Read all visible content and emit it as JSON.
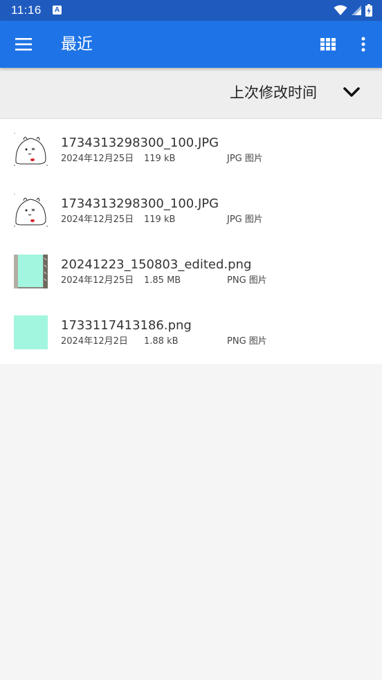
{
  "status_bar": {
    "time": "11:16",
    "notification_glyph": "A",
    "icons": [
      "wifi-icon",
      "signal-icon",
      "battery-icon"
    ]
  },
  "app_bar": {
    "title": "最近",
    "icons": [
      "menu-icon",
      "grid-view-icon",
      "more-vert-icon"
    ],
    "color": "#1e74e6"
  },
  "sort": {
    "label": "上次修改时间",
    "icon": "chevron-down-icon"
  },
  "files": [
    {
      "name": "1734313298300_100.JPG",
      "date": "2024年12月25日",
      "size": "119 kB",
      "type": "JPG 图片",
      "thumb": "cartoon"
    },
    {
      "name": "1734313298300_100.JPG",
      "date": "2024年12月25日",
      "size": "119 kB",
      "type": "JPG 图片",
      "thumb": "cartoon"
    },
    {
      "name": "20241223_150803_edited.png",
      "date": "2024年12月25日",
      "size": "1.85 MB",
      "type": "PNG 图片",
      "thumb": "photo"
    },
    {
      "name": "1733117413186.png",
      "date": "2024年12月2日",
      "size": "1.88 kB",
      "type": "PNG 图片",
      "thumb": "solid"
    }
  ],
  "colors": {
    "status_bar": "#1f5bbf",
    "app_bar": "#1e74e6",
    "thumb_mint": "#a2f5de"
  }
}
